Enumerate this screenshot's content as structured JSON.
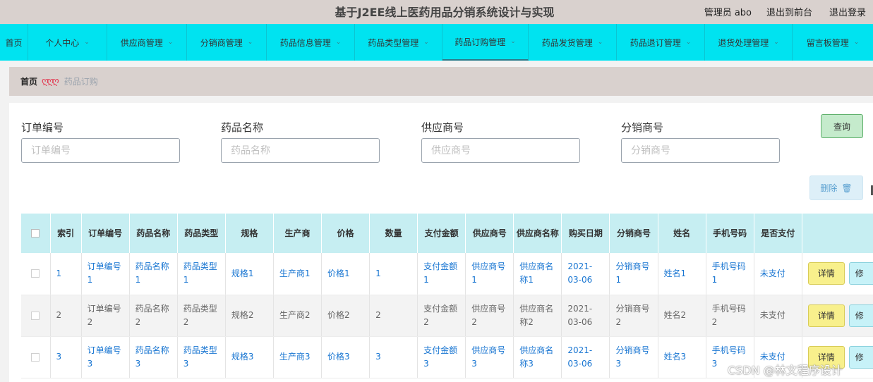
{
  "header": {
    "title": "基于J2EE线上医药用品分销系统设计与实现",
    "user_label": "管理员 abo",
    "to_front_label": "退出到前台",
    "logout_label": "退出登录"
  },
  "nav": {
    "items": [
      {
        "label": "首页",
        "has_caret": false
      },
      {
        "label": "个人中心",
        "has_caret": true
      },
      {
        "label": "供应商管理",
        "has_caret": true
      },
      {
        "label": "分销商管理",
        "has_caret": true
      },
      {
        "label": "药品信息管理",
        "has_caret": true
      },
      {
        "label": "药品类型管理",
        "has_caret": true
      },
      {
        "label": "药品订购管理",
        "has_caret": true,
        "active": true
      },
      {
        "label": "药品发货管理",
        "has_caret": true
      },
      {
        "label": "药品退订管理",
        "has_caret": true
      },
      {
        "label": "退货处理管理",
        "has_caret": true
      },
      {
        "label": "留言板管理",
        "has_caret": true
      }
    ],
    "caret_glyph": "⌄"
  },
  "breadcrumb": {
    "home": "首页",
    "separator": "ღღღ",
    "current": "药品订购"
  },
  "filters": [
    {
      "label": "订单编号",
      "placeholder": "订单编号"
    },
    {
      "label": "药品名称",
      "placeholder": "药品名称"
    },
    {
      "label": "供应商号",
      "placeholder": "供应商号"
    },
    {
      "label": "分销商号",
      "placeholder": "分销商号"
    }
  ],
  "buttons": {
    "search": "查询",
    "delete": "删除",
    "delete_icon": "trash-icon",
    "detail": "详情",
    "edit": "修"
  },
  "table": {
    "headers": [
      "索引",
      "订单编号",
      "药品名称",
      "药品类型",
      "规格",
      "生产商",
      "价格",
      "数量",
      "支付金额",
      "供应商号",
      "供应商名称",
      "购买日期",
      "分销商号",
      "姓名",
      "手机号码",
      "是否支付"
    ],
    "rows": [
      [
        "1",
        "订单编号1",
        "药品名称1",
        "药品类型1",
        "规格1",
        "生产商1",
        "价格1",
        "1",
        "支付金额1",
        "供应商号1",
        "供应商名称1",
        "2021-03-06",
        "分销商号1",
        "姓名1",
        "手机号码1",
        "未支付"
      ],
      [
        "2",
        "订单编号2",
        "药品名称2",
        "药品类型2",
        "规格2",
        "生产商2",
        "价格2",
        "2",
        "支付金额2",
        "供应商号2",
        "供应商名称2",
        "2021-03-06",
        "分销商号2",
        "姓名2",
        "手机号码2",
        "未支付"
      ],
      [
        "3",
        "订单编号3",
        "药品名称3",
        "药品类型3",
        "规格3",
        "生产商3",
        "价格3",
        "3",
        "支付金额3",
        "供应商号3",
        "供应商名称3",
        "2021-03-06",
        "分销商号3",
        "姓名3",
        "手机号码3",
        "未支付"
      ]
    ]
  },
  "watermark": "CSDN @林文程序设计",
  "colors": {
    "nav_bg": "#00e3f0",
    "header_bg": "#d9d1ce",
    "table_header_bg": "#c6eef2",
    "link_blue": "#1976d2",
    "detail_btn": "#f8f08c",
    "search_btn": "#c5ebcc"
  }
}
